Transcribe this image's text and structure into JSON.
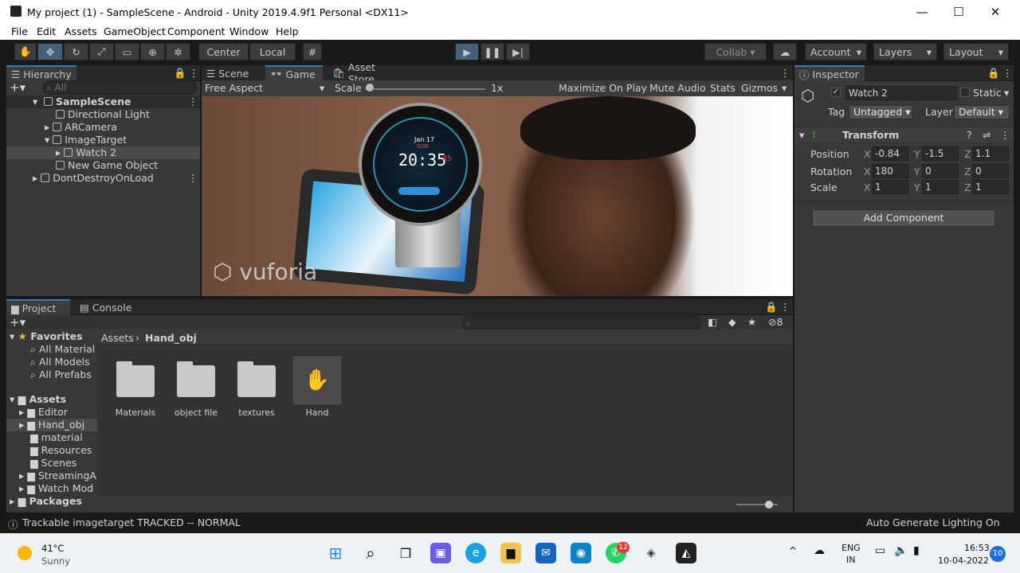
{
  "window": {
    "title": "My project (1) - SampleScene - Android - Unity 2019.4.9f1 Personal <DX11>",
    "minimize": "—",
    "maximize": "☐",
    "close": "✕"
  },
  "menu": [
    "File",
    "Edit",
    "Assets",
    "GameObject",
    "Component",
    "Window",
    "Help"
  ],
  "toolbar": {
    "pivot": "Center",
    "space": "Local",
    "collab": "Collab",
    "account": "Account",
    "layers": "Layers",
    "layout": "Layout"
  },
  "hierarchy": {
    "tab": "Hierarchy",
    "search_placeholder": "All",
    "items": [
      {
        "label": "SampleScene"
      },
      {
        "label": "Directional Light"
      },
      {
        "label": "ARCamera"
      },
      {
        "label": "ImageTarget"
      },
      {
        "label": "Watch 2"
      },
      {
        "label": "New Game Object"
      },
      {
        "label": "DontDestroyOnLoad"
      }
    ]
  },
  "game": {
    "tabs": [
      "Scene",
      "Game",
      "Asset Store"
    ],
    "aspect": "Free Aspect",
    "scale_label": "Scale",
    "scale_value": "1x",
    "scale_level": 0.0,
    "options": [
      "Maximize On Play",
      "Mute Audio",
      "Stats",
      "Gizmos"
    ],
    "watch": {
      "date": "Jan 17",
      "day": "SUN",
      "time": "20:35",
      "seconds": "45"
    },
    "watermark": "vuforia"
  },
  "inspector": {
    "tab": "Inspector",
    "object_name": "Watch 2",
    "static_label": "Static",
    "tag_label": "Tag",
    "tag_value": "Untagged",
    "layer_label": "Layer",
    "layer_value": "Default",
    "transform_label": "Transform",
    "rows": [
      {
        "label": "Position",
        "x": "-0.84",
        "y": "-1.5",
        "z": "1.1"
      },
      {
        "label": "Rotation",
        "x": "180",
        "y": "0",
        "z": "0"
      },
      {
        "label": "Scale",
        "x": "1",
        "y": "1",
        "z": "1"
      }
    ],
    "add_component": "Add Component"
  },
  "project": {
    "tabs": [
      "Project",
      "Console"
    ],
    "hidden_count": "8",
    "breadcrumb": [
      "Assets",
      "Hand_obj"
    ],
    "favorites_label": "Favorites",
    "favorites": [
      "All Material",
      "All Models",
      "All Prefabs"
    ],
    "assets_label": "Assets",
    "asset_folders": [
      "Editor",
      "Hand_obj",
      "material",
      "Resources",
      "Scenes",
      "StreamingA",
      "Watch Mod"
    ],
    "packages_label": "Packages",
    "items": [
      {
        "label": "Materials"
      },
      {
        "label": "object file"
      },
      {
        "label": "textures"
      },
      {
        "label": "Hand"
      }
    ],
    "zoom_level": 0.85
  },
  "status": {
    "message": "Trackable imagetarget TRACKED -- NORMAL",
    "right": "Auto Generate Lighting On"
  },
  "taskbar": {
    "temp": "41°C",
    "weather": "Sunny",
    "whatsapp_badge": "12",
    "lang1": "ENG",
    "lang2": "IN",
    "time": "16:53",
    "date": "10-04-2022",
    "notif": "10"
  }
}
